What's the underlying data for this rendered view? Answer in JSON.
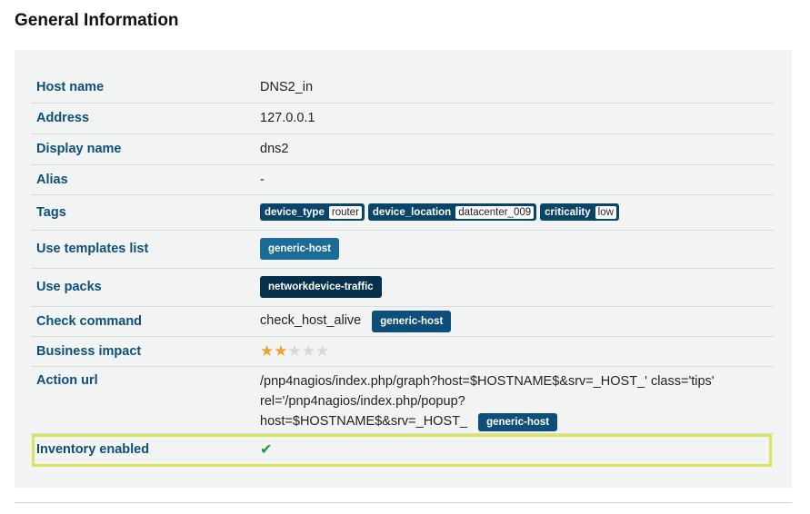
{
  "page": {
    "title": "General Information"
  },
  "rows": {
    "host_name": {
      "label": "Host name",
      "value": "DNS2_in"
    },
    "address": {
      "label": "Address",
      "value": "127.0.0.1"
    },
    "display_name": {
      "label": "Display name",
      "value": "dns2"
    },
    "alias": {
      "label": "Alias",
      "value": "-"
    },
    "tags": {
      "label": "Tags",
      "items": [
        {
          "key": "device_type",
          "value": "router"
        },
        {
          "key": "device_location",
          "value": "datacenter_009"
        },
        {
          "key": "criticality",
          "value": "low"
        }
      ]
    },
    "use_templates": {
      "label": "Use templates list",
      "badge": "generic-host"
    },
    "use_packs": {
      "label": "Use packs",
      "badge": "networkdevice-traffic"
    },
    "check_command": {
      "label": "Check command",
      "value": "check_host_alive",
      "badge": "generic-host"
    },
    "business_impact": {
      "label": "Business impact",
      "stars_filled": 2,
      "stars_total": 5
    },
    "action_url": {
      "label": "Action url",
      "line1": "/pnp4nagios/index.php/graph?host=$HOSTNAME$&srv=_HOST_' class='tips'",
      "line2": "rel='/pnp4nagios/index.php/popup?",
      "line3": "host=$HOSTNAME$&srv=_HOST_",
      "badge": "generic-host"
    },
    "inventory_enabled": {
      "label": "Inventory enabled",
      "value": "✔"
    }
  },
  "colors": {
    "label": "#0d4f7a",
    "badge": "#1a6b96",
    "highlight": "#dde356",
    "check": "#1a9a3a",
    "star": "#f0a030"
  }
}
